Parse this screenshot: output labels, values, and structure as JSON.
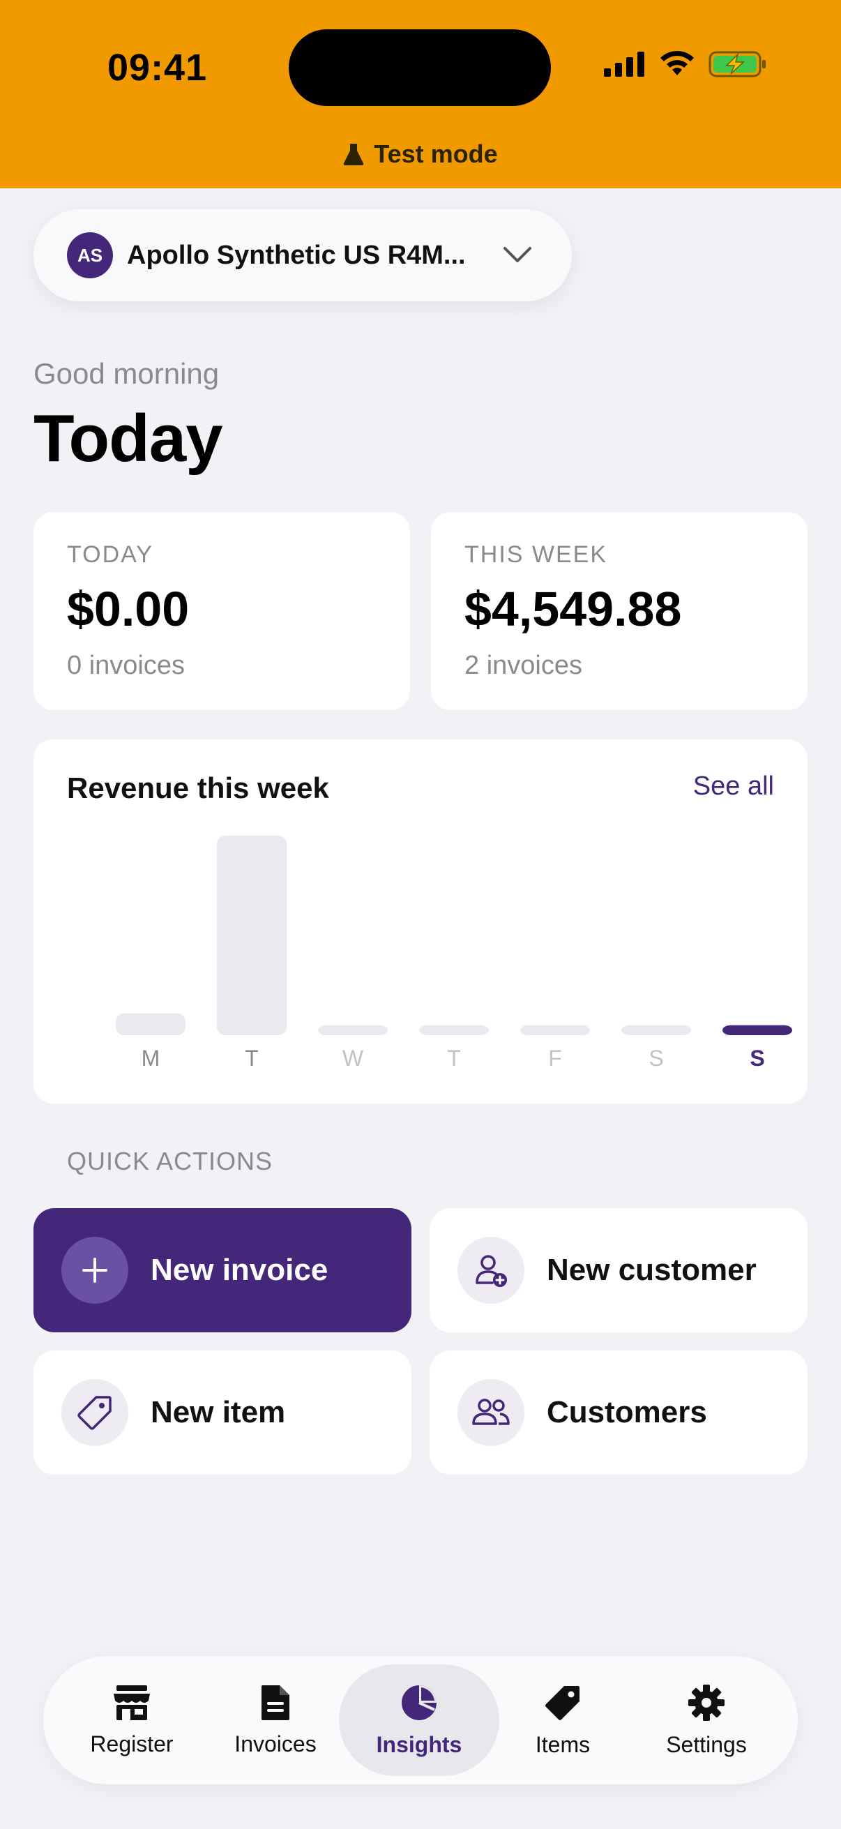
{
  "status_bar": {
    "time": "09:41",
    "banner_text": "Test mode"
  },
  "account": {
    "initials": "AS",
    "name": "Apollo Synthetic US R4M..."
  },
  "header": {
    "greeting": "Good morning",
    "title": "Today"
  },
  "stats": [
    {
      "label": "TODAY",
      "value": "$0.00",
      "sub": "0 invoices"
    },
    {
      "label": "THIS WEEK",
      "value": "$4,549.88",
      "sub": "2 invoices"
    }
  ],
  "revenue_card": {
    "title": "Revenue this week",
    "see_all": "See all"
  },
  "chart_data": {
    "type": "bar",
    "categories": [
      "M",
      "T",
      "W",
      "T",
      "F",
      "S",
      "S"
    ],
    "values": [
      0.11,
      1.0,
      0.05,
      0.05,
      0.05,
      0.05,
      0.05
    ],
    "highlight_index": 6
  },
  "quick_actions": {
    "label": "QUICK ACTIONS",
    "items": [
      {
        "label": "New invoice",
        "icon": "plus-icon"
      },
      {
        "label": "New customer",
        "icon": "add-person-icon"
      },
      {
        "label": "New item",
        "icon": "tag-icon"
      },
      {
        "label": "Customers",
        "icon": "people-icon"
      }
    ]
  },
  "tabs": [
    {
      "label": "Register",
      "icon": "store-icon"
    },
    {
      "label": "Invoices",
      "icon": "document-icon"
    },
    {
      "label": "Insights",
      "icon": "pie-chart-icon",
      "active": true
    },
    {
      "label": "Items",
      "icon": "tag-icon"
    },
    {
      "label": "Settings",
      "icon": "gear-icon"
    }
  ],
  "colors": {
    "banner": "#f09a00",
    "accent": "#442778",
    "bar_inactive": "#ebe9ef"
  }
}
